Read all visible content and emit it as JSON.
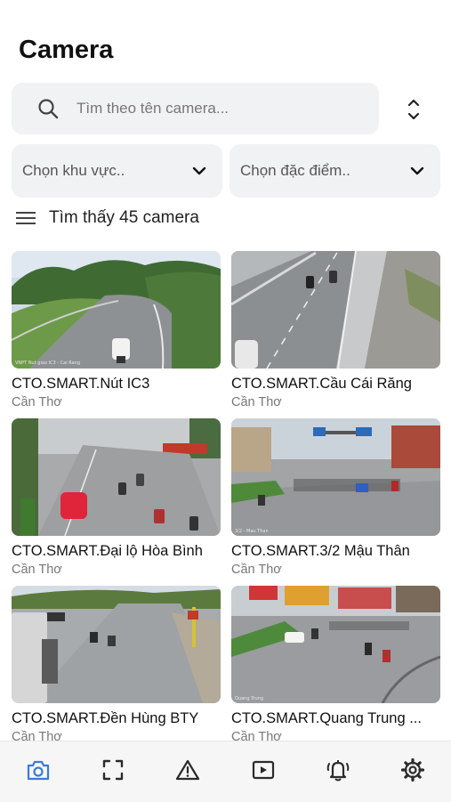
{
  "header": {
    "title": "Camera"
  },
  "search": {
    "placeholder": "Tìm theo tên camera..."
  },
  "filters": {
    "area_placeholder": "Chọn khu vực..",
    "feature_placeholder": "Chọn đặc điểm.."
  },
  "results": {
    "count_text": "Tìm thấy 45 camera"
  },
  "cameras": [
    {
      "name": "CTO.SMART.Nút IC3",
      "area": "Cần Thơ",
      "watermark": "VNPT Nut giao IC3 - Cai Rang"
    },
    {
      "name": "CTO.SMART.Cầu Cái Răng",
      "area": "Cần Thơ"
    },
    {
      "name": "CTO.SMART.Đại lộ Hòa Bình",
      "area": "Cần Thơ"
    },
    {
      "name": "CTO.SMART.3/2 Mậu Thân",
      "area": "Cần Thơ",
      "watermark": "3/2 - Mau Than"
    },
    {
      "name": "CTO.SMART.Đền Hùng BTY",
      "area": "Cần Thơ"
    },
    {
      "name": "CTO.SMART.Quang Trung ...",
      "area": "Cần Thơ",
      "watermark": "Quang Trung"
    }
  ],
  "tabbar": {
    "items": [
      "camera-icon",
      "scan-frame-icon",
      "warning-icon",
      "video-play-icon",
      "bell-alert-icon",
      "settings-icon"
    ],
    "active": "camera-icon",
    "active_color": "#3b7bd6",
    "inactive_color": "#2b2b2b"
  }
}
